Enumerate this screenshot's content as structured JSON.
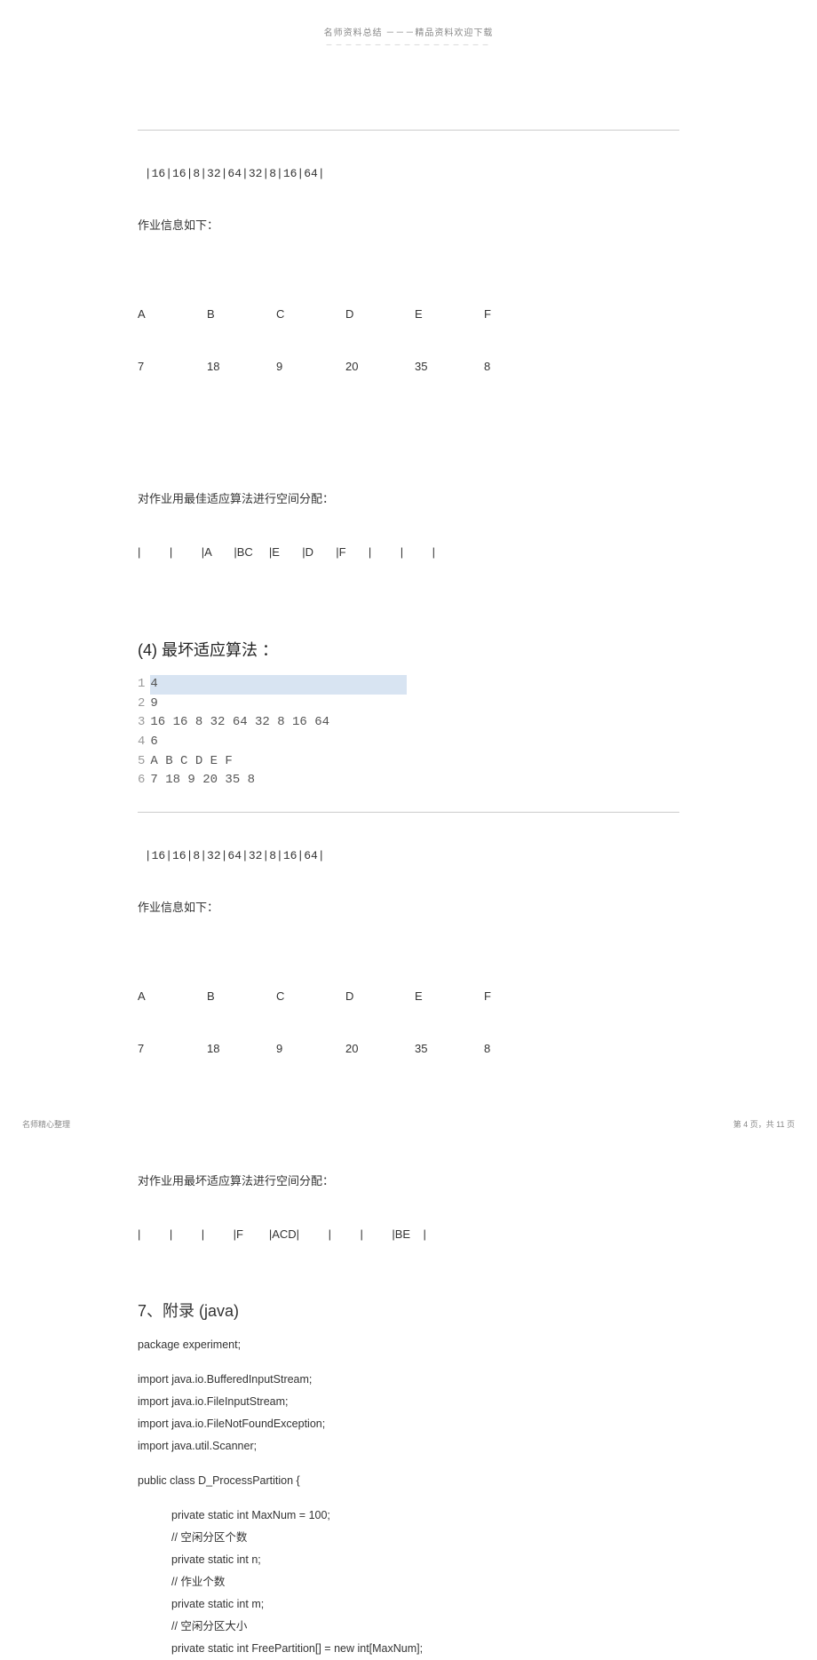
{
  "header": {
    "title": "名师资料总结 －－－精品资料欢迎下载",
    "subtitle": "－－－－－－－－－－－－－－－－－"
  },
  "block1": {
    "partition_line": " |16|16|8|32|64|32|8|16|64|",
    "jobs_header": "作业信息如下：",
    "job_labels": [
      "A",
      "B",
      "C",
      "D",
      "E",
      "F"
    ],
    "job_values": [
      "7",
      "18",
      "9",
      "20",
      "35",
      "8"
    ],
    "alloc_header": "对作业用最佳适应算法进行空间分配：",
    "alloc_row": "|         |         |A       |BC     |E       |D       |F       |         |         |"
  },
  "section4_title": "(4) 最坏适应算法 ：",
  "input_block": {
    "lines": [
      {
        "ln": "1",
        "txt": "4",
        "hl": true
      },
      {
        "ln": "2",
        "txt": "9",
        "hl": false
      },
      {
        "ln": "3",
        "txt": "16 16 8 32 64 32 8 16 64",
        "hl": false
      },
      {
        "ln": "4",
        "txt": "6",
        "hl": false
      },
      {
        "ln": "5",
        "txt": "A B C D E F",
        "hl": false
      },
      {
        "ln": "6",
        "txt": "7 18 9 20 35 8",
        "hl": false
      }
    ]
  },
  "block2": {
    "partition_line": " |16|16|8|32|64|32|8|16|64|",
    "jobs_header": "作业信息如下：",
    "job_labels": [
      "A",
      "B",
      "C",
      "D",
      "E",
      "F"
    ],
    "job_values": [
      "7",
      "18",
      "9",
      "20",
      "35",
      "8"
    ],
    "alloc_header": "对作业用最坏适应算法进行空间分配：",
    "alloc_row": "|         |         |         |F        |ACD|         |         |         |BE    |"
  },
  "appendix_title": "7、附录 (java)",
  "java": {
    "l1": "package experiment;",
    "l2": "import java.io.BufferedInputStream;",
    "l3": "import java.io.FileInputStream;",
    "l4": "import java.io.FileNotFoundException;",
    "l5": "import java.util.Scanner;",
    "l6": "public class D_ProcessPartition {",
    "l7": "private static int MaxNum = 100;",
    "l8": "//  空闲分区个数",
    "l9": "private static int n;",
    "l10": "//  作业个数",
    "l11": "private static int m;",
    "l12": "//  空闲分区大小",
    "l13": "private static int FreePartition[] = new int[MaxNum];"
  },
  "footer": {
    "left": "名师精心整理",
    "right": "第 4 页，共 11 页"
  },
  "chart_data": [
    {
      "type": "table",
      "title": "最佳适应算法 (Best Fit)",
      "partitions": [
        16,
        16,
        8,
        32,
        64,
        32,
        8,
        16,
        64
      ],
      "jobs": {
        "A": 7,
        "B": 18,
        "C": 9,
        "D": 20,
        "E": 35,
        "F": 8
      },
      "allocation": [
        "",
        "",
        "A",
        "BC",
        "E",
        "D",
        "F",
        "",
        ""
      ]
    },
    {
      "type": "table",
      "title": "最坏适应算法 (Worst Fit)",
      "partitions": [
        16,
        16,
        8,
        32,
        64,
        32,
        8,
        16,
        64
      ],
      "jobs": {
        "A": 7,
        "B": 18,
        "C": 9,
        "D": 20,
        "E": 35,
        "F": 8
      },
      "allocation": [
        "",
        "",
        "",
        "F",
        "ACD",
        "",
        "",
        "",
        "BE"
      ]
    }
  ]
}
